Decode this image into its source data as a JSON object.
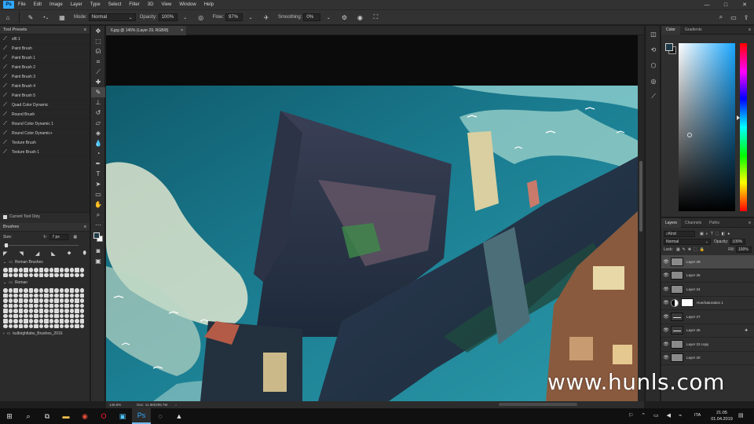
{
  "menubar": {
    "logo": "Ps",
    "items": [
      "File",
      "Edit",
      "Image",
      "Layer",
      "Type",
      "Select",
      "Filter",
      "3D",
      "View",
      "Window",
      "Help"
    ],
    "controls": {
      "minimize": "—",
      "maximize": "□",
      "close": "✕"
    }
  },
  "options_bar": {
    "mode_label": "Mode:",
    "mode_value": "Normal",
    "opacity_label": "Opacity:",
    "opacity_value": "100%",
    "flow_label": "Flow:",
    "flow_value": "97%",
    "smoothing_label": "Smoothing:",
    "smoothing_value": "0%"
  },
  "tool_presets": {
    "title": "Tool Presets",
    "items": [
      "sf6 1",
      "Paint Brush",
      "Paint Brush 1",
      "Paint Brush 2",
      "Paint Brush 3",
      "Paint Brush 4",
      "Paint Brush 5",
      "Quad Color Dynamic",
      "Round Brush",
      "Round Color Dynamic 1",
      "Round Color Dynamic+",
      "Texture Brush",
      "Texture Brush 1"
    ],
    "footer": "Current Tool Only"
  },
  "brushes": {
    "title": "Brushes",
    "size_label": "Size:",
    "size_value": "7 px",
    "group_1": "Roman Brushes",
    "group_2": "Roman",
    "group_3": "kulbrightlabs_Brushes_2016"
  },
  "document": {
    "tab_title": "6.jpg @ 145% (Layer 29, RGB/8)",
    "tab_close": "×",
    "status_zoom": "145.8%",
    "status_doc": "Doc: 11.9M/295.7M"
  },
  "color_panel": {
    "tabs": [
      "Color",
      "Gradients"
    ]
  },
  "layers_panel": {
    "tabs": [
      "Layers",
      "Channels",
      "Paths"
    ],
    "filter_label": "Kind",
    "blend_mode": "Normal",
    "opacity_label": "Opacity:",
    "opacity_value": "100%",
    "lock_label": "Lock:",
    "fill_label": "Fill:",
    "fill_value": "100%",
    "layers": [
      "Layer 29",
      "Layer 25",
      "Layer 24",
      "Hue/Saturation 1",
      "Layer 27",
      "Layer 26",
      "Layer 23 copy",
      "Layer 20"
    ]
  },
  "watermark": "www.hunls.com",
  "taskbar": {
    "language": "ITA",
    "time": "21:05",
    "date": "01.04.2019"
  },
  "colors": {
    "panel": "#2f2f2f",
    "accent": "#31a8ff",
    "foreground_swatch": "#1e3a46"
  }
}
